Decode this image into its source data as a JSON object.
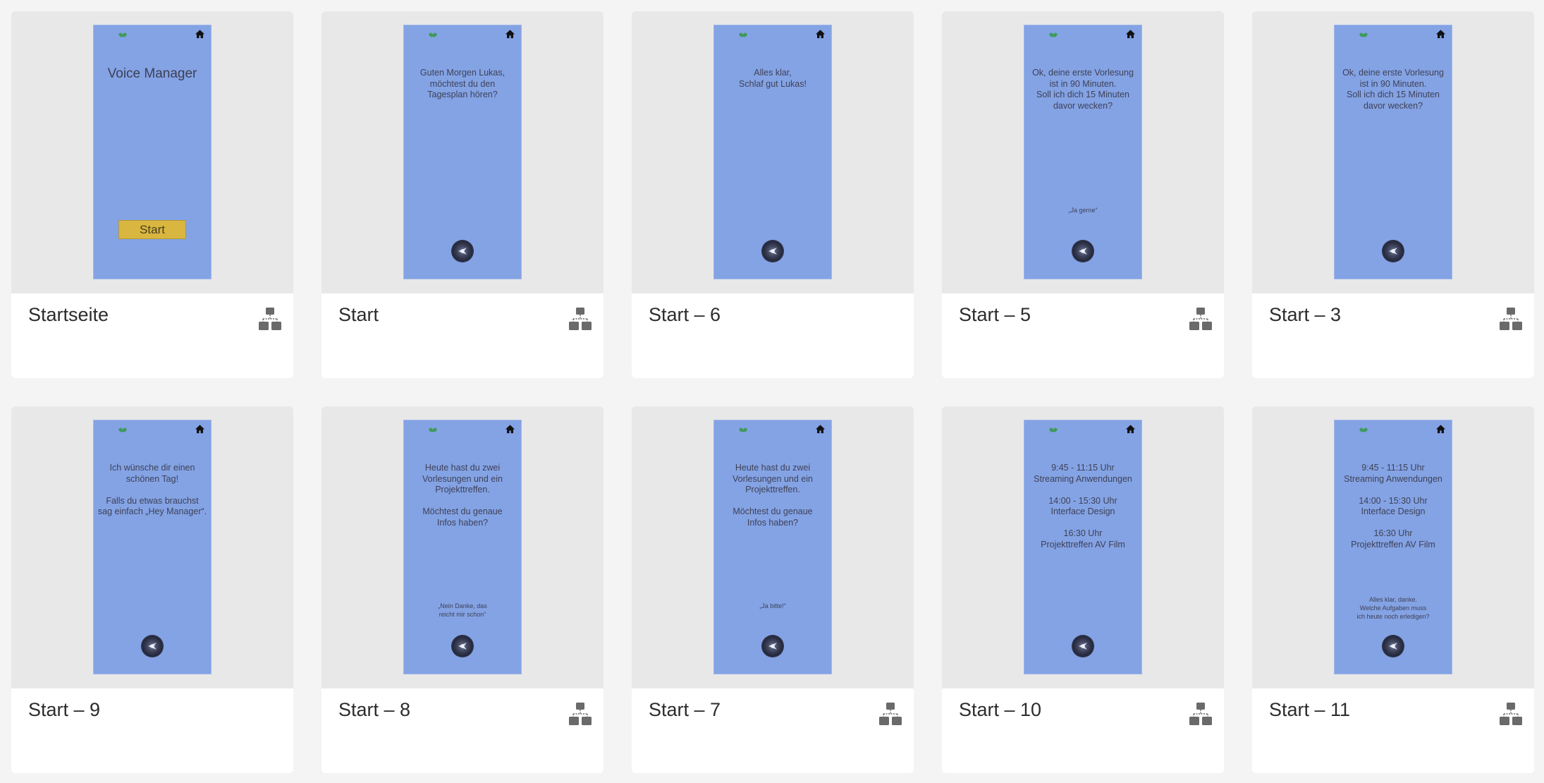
{
  "colors": {
    "page_bg": "#f4f4f4",
    "thumb_bg": "#e8e8e8",
    "phone_bg": "#84a3e4",
    "start_button": "#d9b63f"
  },
  "icons": {
    "home": "home-icon",
    "mic": "mic-orb-icon",
    "flow": "flow-hierarchy-icon"
  },
  "cards": [
    {
      "label": "Startseite",
      "screen": {
        "title": "Voice Manager",
        "button": "Start"
      }
    },
    {
      "label": "Start",
      "screen": {
        "text": "Guten Morgen Lukas,\nmöchtest du den\nTagesplan hören?"
      }
    },
    {
      "label": "Start – 6",
      "screen": {
        "text": "Alles klar,\nSchlaf gut Lukas!"
      }
    },
    {
      "label": "Start – 5",
      "screen": {
        "text": "Ok, deine erste Vorlesung\nist in 90 Minuten.\nSoll ich dich 15 Minuten\ndavor wecken?",
        "reply": "„Ja gerne“"
      }
    },
    {
      "label": "Start – 3",
      "screen": {
        "text": "Ok, deine erste Vorlesung\nist in 90 Minuten.\nSoll ich dich 15 Minuten\ndavor wecken?"
      }
    },
    {
      "label": "Start – 9",
      "screen": {
        "text": "Ich wünsche dir einen\nschönen Tag!\n\nFalls du etwas brauchst\nsag einfach „Hey Manager“."
      }
    },
    {
      "label": "Start – 8",
      "screen": {
        "text": "Heute hast du zwei\nVorlesungen und ein\nProjekttreffen.\n\nMöchtest du genaue\nInfos haben?",
        "reply": "„Nein Danke, das\nreicht mir schon“"
      }
    },
    {
      "label": "Start – 7",
      "screen": {
        "text": "Heute hast du zwei\nVorlesungen und ein\nProjekttreffen.\n\nMöchtest du genaue\nInfos haben?",
        "reply": "„Ja bitte!“"
      }
    },
    {
      "label": "Start – 10",
      "screen": {
        "text": "9:45 - 11:15 Uhr\nStreaming Anwendungen\n\n14:00 - 15:30 Uhr\nInterface Design\n\n16:30 Uhr\nProjekttreffen AV Film"
      }
    },
    {
      "label": "Start – 11",
      "screen": {
        "text": "9:45 - 11:15 Uhr\nStreaming Anwendungen\n\n14:00 - 15:30 Uhr\nInterface Design\n\n16:30 Uhr\nProjekttreffen AV Film",
        "reply": "Alles klar, danke.\nWelche Aufgaben muss\nich heute noch erledigen?"
      }
    }
  ]
}
